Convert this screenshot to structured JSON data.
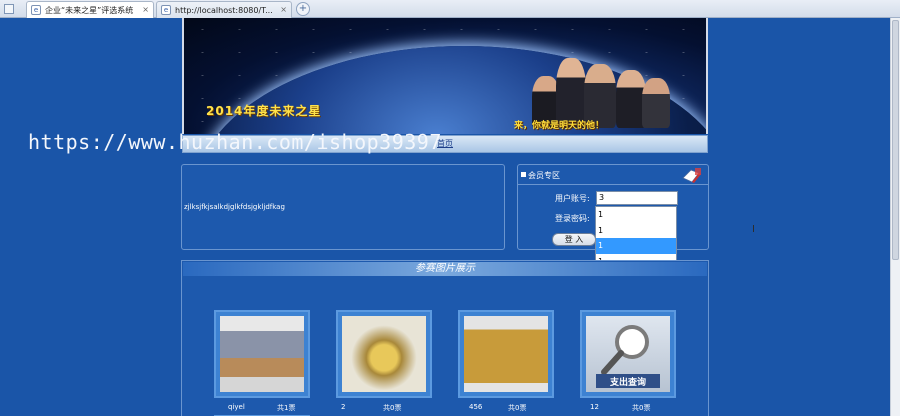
{
  "browser": {
    "tabs": [
      {
        "title": "企业“未来之星”评选系统",
        "active": true
      },
      {
        "title": "http://localhost:8080/T...",
        "active": false
      }
    ],
    "close_glyph": "×",
    "new_tab_glyph": "+"
  },
  "banner": {
    "title": "2014年度未来之星",
    "slogan": "来，你就是明天的他！"
  },
  "nav": {
    "home": "首页"
  },
  "watermark": "https://www.huzhan.com/ishop39397",
  "news": {
    "text": "zjlksjfkjsalkdjglkfdsjgkljdfkag"
  },
  "member": {
    "title": "会员专区",
    "username_label": "用户账号:",
    "username_value": "3",
    "password_label": "登录密码:",
    "password_value": "1",
    "login_label": "登  入",
    "autocomplete": [
      "1",
      "1",
      "1",
      "1"
    ]
  },
  "gallery": {
    "title": "参赛图片展示",
    "items": [
      {
        "name": "qiyel",
        "votes": "共1票",
        "cover": "book"
      },
      {
        "name": "2",
        "votes": "共0票",
        "cover": "machine"
      },
      {
        "name": "456",
        "votes": "共0票",
        "cover": "physics"
      },
      {
        "name": "12",
        "votes": "共0票",
        "cover": "search"
      }
    ],
    "search_card_text": "支出查询"
  },
  "colors": {
    "page_bg": "#1a55a8",
    "panel_border": "#6a95cf",
    "highlight": "#3399ff",
    "banner_gold": "#ffe24a"
  }
}
